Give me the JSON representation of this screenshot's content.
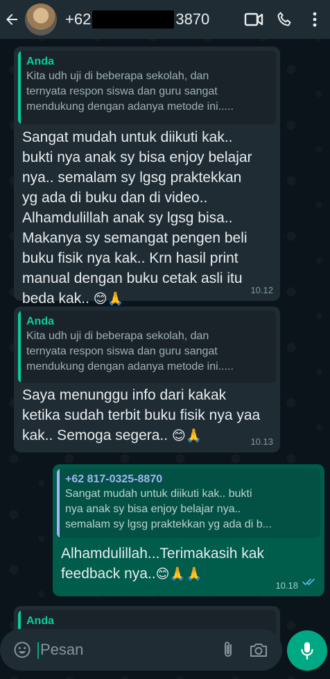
{
  "header": {
    "contact_prefix": "+62",
    "contact_suffix": "3870",
    "icons": [
      "back-arrow-icon",
      "video-call-icon",
      "phone-icon"
    ]
  },
  "messages": [
    {
      "direction": "incoming",
      "quote_author": "Anda",
      "quote_text": "Kita udh uji di beberapa sekolah, dan\nternyata respon siswa dan guru sangat\nmendukung dengan adanya metode ini.....",
      "text": "Sangat mudah untuk diikuti kak..\nbukti nya anak sy bisa enjoy belajar\nnya.. semalam sy lgsg praktekkan\nyg ada di buku dan di video..\nAlhamdulillah anak sy lgsg bisa..\nMakanya sy semangat pengen beli\nbuku fisik nya kak.. Krn hasil print\nmanual dengan buku cetak asli itu\nbeda kak..",
      "emoji": "😊🙏",
      "time": "10.12"
    },
    {
      "direction": "incoming",
      "quote_author": "Anda",
      "quote_text": "Kita udh uji di beberapa sekolah, dan\nternyata respon siswa dan guru sangat\nmendukung dengan adanya metode ini.....",
      "text": "Saya menunggu info dari kakak\nketika sudah terbit buku fisik nya yaa\nkak.. Semoga segera..",
      "emoji": "😊🙏",
      "time": "10.13"
    },
    {
      "direction": "outgoing",
      "quote_author": "+62 817-0325-8870",
      "quote_text": "Sangat mudah untuk diikuti kak.. bukti\nnya anak sy bisa enjoy belajar nya..\nsemalam sy lgsg praktekkan yg ada di b...",
      "text": "Alhamdulillah...Terimakasih kak\nfeedback nya..",
      "emoji": "😊🙏🙏",
      "time": "10.18",
      "status": "read"
    },
    {
      "direction": "incoming",
      "quote_author": "Anda",
      "partial": true
    }
  ],
  "input": {
    "placeholder": "Pesan",
    "icons": [
      "emoji-icon",
      "attach-icon",
      "camera-icon",
      "mic-icon"
    ]
  },
  "colors": {
    "background": "#0b141a",
    "header": "#1f2c34",
    "incoming_bubble": "#1f2c34",
    "outgoing_bubble": "#005c4b",
    "accent": "#00a884",
    "quote_author_incoming": "#06cf9c",
    "quote_author_outgoing": "#a5b3f5",
    "read_ticks": "#53bdeb"
  }
}
